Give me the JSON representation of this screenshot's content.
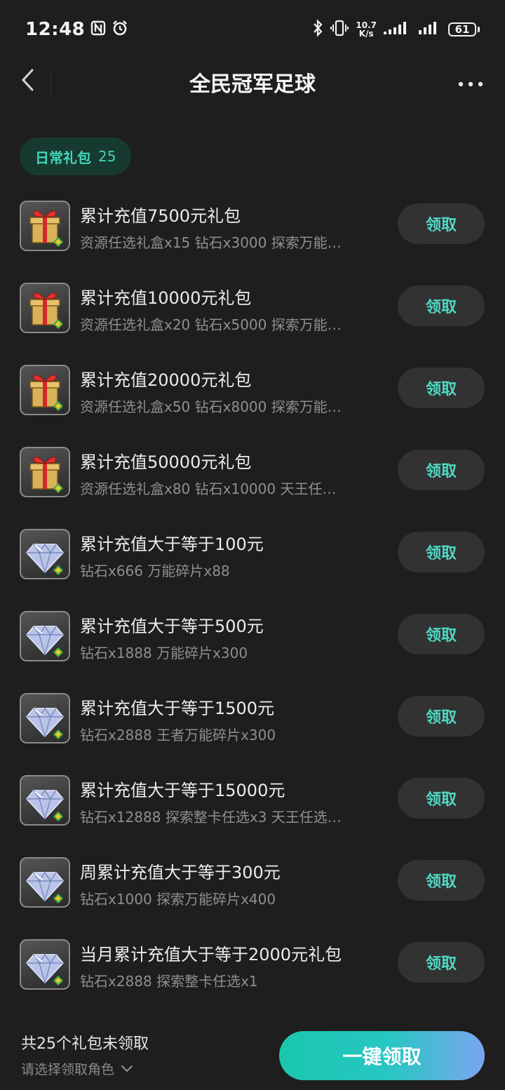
{
  "status_bar": {
    "time": "12:48",
    "net_speed_value": "10.7",
    "net_speed_unit": "K/s",
    "battery": "61"
  },
  "header": {
    "title": "全民冠军足球"
  },
  "category": {
    "label": "日常礼包",
    "count": "25"
  },
  "items": [
    {
      "icon": "gift-box-icon",
      "title": "累计充值7500元礼包",
      "desc": "资源任选礼盒x15 钻石x3000 探索万能…",
      "button": "领取"
    },
    {
      "icon": "gift-box-icon",
      "title": "累计充值10000元礼包",
      "desc": "资源任选礼盒x20 钻石x5000 探索万能…",
      "button": "领取"
    },
    {
      "icon": "gift-box-icon",
      "title": "累计充值20000元礼包",
      "desc": "资源任选礼盒x50 钻石x8000 探索万能…",
      "button": "领取"
    },
    {
      "icon": "gift-box-icon",
      "title": "累计充值50000元礼包",
      "desc": "资源任选礼盒x80 钻石x10000 天王任…",
      "button": "领取"
    },
    {
      "icon": "diamond-icon",
      "title": "累计充值大于等于100元",
      "desc": "钻石x666 万能碎片x88",
      "button": "领取"
    },
    {
      "icon": "diamond-icon",
      "title": "累计充值大于等于500元",
      "desc": "钻石x1888 万能碎片x300",
      "button": "领取"
    },
    {
      "icon": "diamond-icon",
      "title": "累计充值大于等于1500元",
      "desc": "钻石x2888 王者万能碎片x300",
      "button": "领取"
    },
    {
      "icon": "diamond-icon",
      "title": "累计充值大于等于15000元",
      "desc": "钻石x12888 探索整卡任选x3 天王任选…",
      "button": "领取"
    },
    {
      "icon": "diamond-icon",
      "title": "周累计充值大于等于300元",
      "desc": "钻石x1000 探索万能碎片x400",
      "button": "领取"
    },
    {
      "icon": "diamond-icon",
      "title": "当月累计充值大于等于2000元礼包",
      "desc": "钻石x2888 探索整卡任选x1",
      "button": "领取"
    }
  ],
  "footer": {
    "unclaimed_text": "共25个礼包未领取",
    "select_role": "请选择领取角色",
    "claim_all": "一键领取"
  },
  "colors": {
    "background": "#1e1e1e",
    "accent": "#4fd9c3",
    "chip_bg": "#173a30",
    "button_bg": "#323232"
  }
}
